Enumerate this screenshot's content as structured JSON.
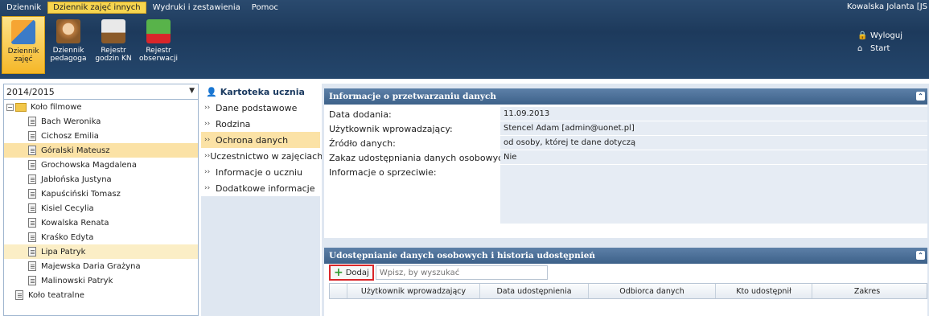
{
  "menu": [
    {
      "label": "Dziennik",
      "active": false
    },
    {
      "label": "Dziennik zajęć innych",
      "active": true
    },
    {
      "label": "Wydruki i zestawienia",
      "active": false
    },
    {
      "label": "Pomoc",
      "active": false
    }
  ],
  "user": {
    "name": "Kowalska Jolanta [JS"
  },
  "toolbar": [
    {
      "label": "Dziennik zajęć",
      "icon": "journal-icon",
      "active": true
    },
    {
      "label": "Dziennik pedagoga",
      "icon": "pedagogue-icon",
      "active": false
    },
    {
      "label": "Rejestr godzin KN",
      "icon": "register-hours-icon",
      "active": false
    },
    {
      "label": "Rejestr obserwacji",
      "icon": "observation-register-icon",
      "active": false
    }
  ],
  "top_links": {
    "logout": "Wyloguj",
    "start": "Start"
  },
  "year_select": {
    "value": "2014/2015"
  },
  "tree": {
    "group1": "Koło filmowe",
    "students": [
      "Bach Weronika",
      "Cichosz Emilia",
      "Góralski Mateusz",
      "Grochowska Magdalena",
      "Jabłońska Justyna",
      "Kapuściński Tomasz",
      "Kisiel Cecylia",
      "Kowalska Renata",
      "Kraśko Edyta",
      "Lipa Patryk",
      "Majewska Daria Grażyna",
      "Malinowski Patryk"
    ],
    "group2": "Koło teatralne"
  },
  "mid": {
    "title": "Kartoteka ucznia",
    "items": [
      "Dane podstawowe",
      "Rodzina",
      "Ochrona danych",
      "Uczestnictwo w zajęciach",
      "Informacje o uczniu",
      "Dodatkowe informacje"
    ]
  },
  "info_panel": {
    "title": "Informacje o przetwarzaniu danych",
    "rows": [
      {
        "label": "Data dodania:",
        "value": "11.09.2013"
      },
      {
        "label": "Użytkownik wprowadzający:",
        "value": "Stencel Adam [admin@uonet.pl]"
      },
      {
        "label": "Źródło danych:",
        "value": "od osoby, której te dane dotyczą"
      },
      {
        "label": "Zakaz udostępniania danych osobowych:",
        "value": "Nie"
      },
      {
        "label": "Informacje o sprzeciwie:",
        "value": ""
      }
    ]
  },
  "share_panel": {
    "title": "Udostępnianie danych osobowych i historia udostępnień",
    "add_label": "Dodaj",
    "search_placeholder": "Wpisz, by wyszukać",
    "columns": [
      "Użytkownik wprowadzający",
      "Data udostępnienia",
      "Odbiorca danych",
      "Kto udostępnił",
      "Zakres"
    ]
  },
  "colors": {
    "accent": "#f6d54f",
    "header": "#3d6189",
    "selected": "#fbe2a6",
    "highlight_border": "#d9262a"
  }
}
